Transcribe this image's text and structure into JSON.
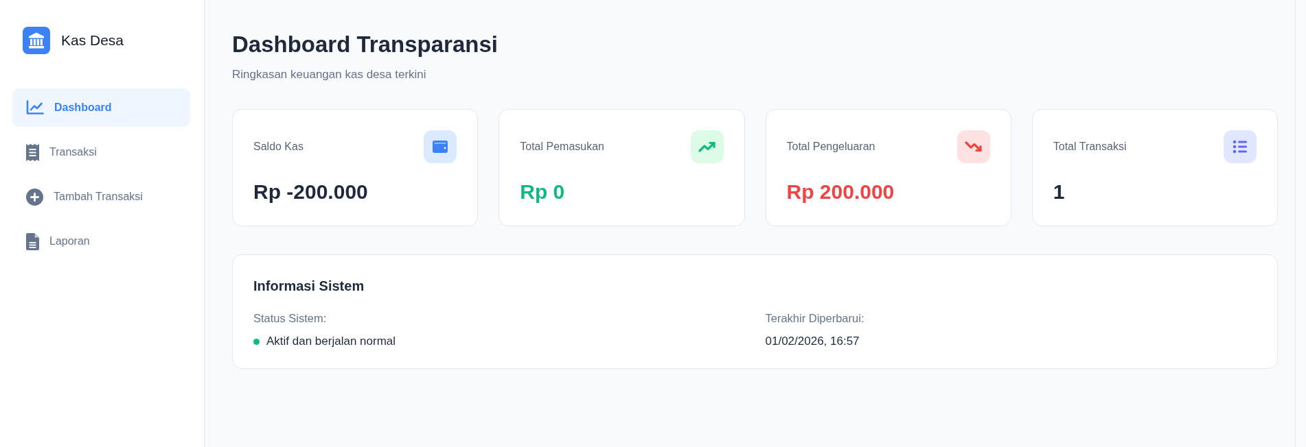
{
  "sidebar": {
    "brand": "Kas Desa",
    "nav": [
      {
        "label": "Dashboard",
        "selected": true
      },
      {
        "label": "Transaksi",
        "selected": false
      },
      {
        "label": "Tambah Transaksi",
        "selected": false
      },
      {
        "label": "Laporan",
        "selected": false
      }
    ]
  },
  "header": {
    "title": "Dashboard Transparansi",
    "subtitle": "Ringkasan keuangan kas desa terkini"
  },
  "cards": [
    {
      "label": "Saldo Kas",
      "value": {
        "text": "Rp -200.000",
        "color": "#1e293b"
      }
    },
    {
      "label": "Total Pemasukan",
      "value": {
        "text": "Rp 0",
        "color": "#10b981"
      }
    },
    {
      "label": "Total Pengeluaran",
      "value": {
        "text": "Rp 200.000",
        "color": "#ef4444"
      }
    },
    {
      "label": "Total Transaksi",
      "value": {
        "text": "1",
        "color": "#1e293b"
      }
    }
  ],
  "info": {
    "title": "Informasi Sistem",
    "fields": [
      {
        "label": "Status Sistem:",
        "value": "Aktif dan berjalan normal",
        "color": "#10b981"
      },
      {
        "label": "Terakhir Diperbarui:",
        "value": "01/02/2026, 16:57"
      }
    ]
  }
}
